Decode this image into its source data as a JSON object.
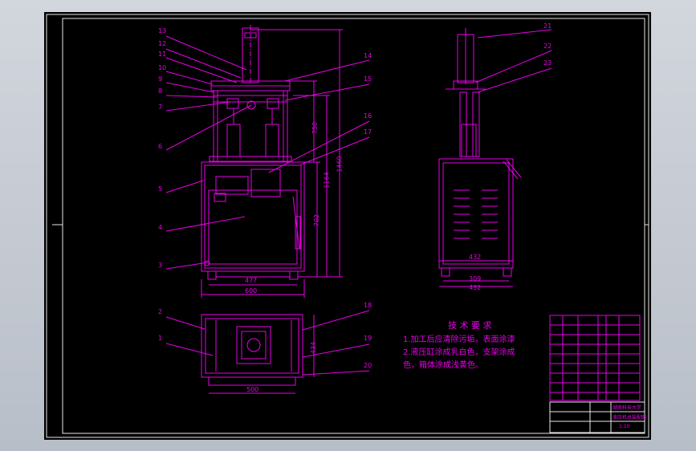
{
  "drawing": {
    "part_numbers": [
      "13",
      "12",
      "11",
      "10",
      "9",
      "8",
      "7",
      "6",
      "5",
      "4",
      "3",
      "2",
      "1",
      "14",
      "15",
      "16",
      "17",
      "18",
      "19",
      "20",
      "21",
      "22",
      "23"
    ],
    "dimensions": {
      "front_inner_width": "477",
      "front_outer_width": "600",
      "height_750": "750",
      "height_1460": "1460",
      "height_1164": "1164",
      "height_702": "702",
      "side_width_432_top": "432",
      "side_width_309": "309",
      "side_width_432_bottom": "432",
      "plan_width": "500",
      "plan_height": "434"
    },
    "notes": {
      "title": "技 术 要 求",
      "line1": "1.加工后应清除污垢，表面涂漆",
      "line2": "2.液压缸涂成乳白色，支架涂成",
      "line3": "色，箱体涂成浅黄色。"
    }
  },
  "title_block": {
    "school": "湖南科技大学",
    "drawing_name": "液压机总装配图",
    "scale": "1:10"
  },
  "colors": {
    "lines": "#e800e8",
    "background": "#000000",
    "border": "#ffffff"
  }
}
